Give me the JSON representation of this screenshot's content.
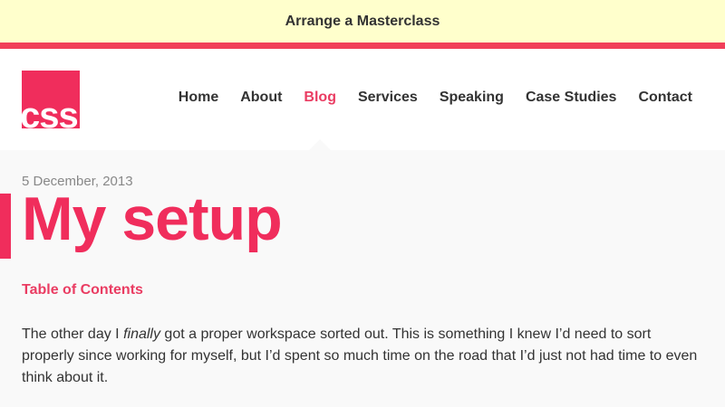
{
  "promo": {
    "label": "Arrange a Masterclass"
  },
  "logo": {
    "text": "css"
  },
  "nav": {
    "items": [
      {
        "label": "Home"
      },
      {
        "label": "About"
      },
      {
        "label": "Blog"
      },
      {
        "label": "Services"
      },
      {
        "label": "Speaking"
      },
      {
        "label": "Case Studies"
      },
      {
        "label": "Contact"
      }
    ],
    "active": "Blog"
  },
  "post": {
    "date": "5 December, 2013",
    "title": "My setup",
    "toc_label": "Table of Contents",
    "intro_before": "The other day I ",
    "intro_emphasis": "finally",
    "intro_after": " got a proper workspace sorted out. This is something I knew I’d need to sort properly since working for myself, but I’d spent so much time on the road that I’d just not had time to even think about it."
  },
  "colors": {
    "accent": "#f02d5c",
    "promo_bg": "#ffffcc",
    "text": "#333333"
  }
}
